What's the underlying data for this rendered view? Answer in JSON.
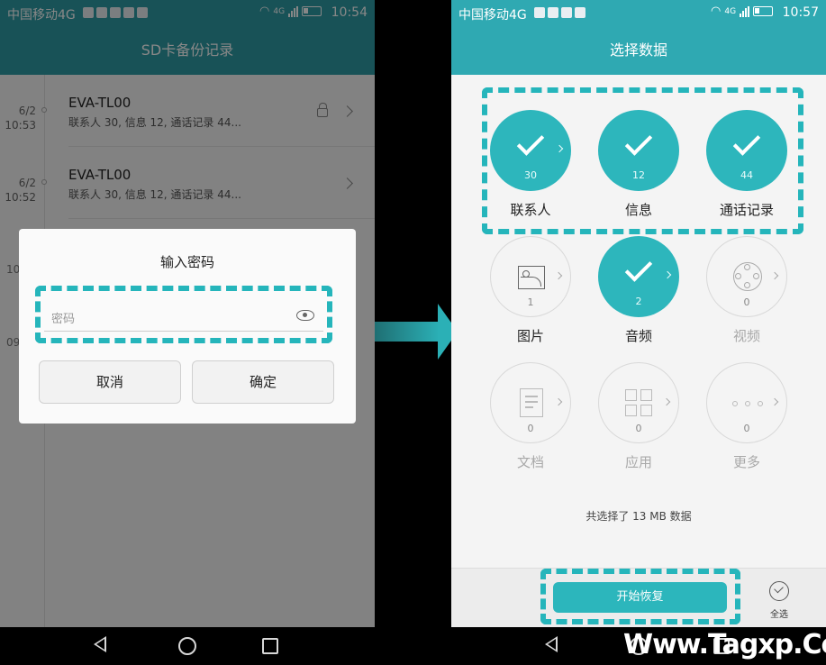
{
  "left": {
    "status": {
      "carrier": "中国移动4G",
      "time": "10:54",
      "network": "4G"
    },
    "title": "SD卡备份记录",
    "records": [
      {
        "date": "6/2",
        "time": "10:53",
        "name": "EVA-TL00",
        "detail": "联系人 30, 信息 12, 通话记录 44...",
        "locked": true
      },
      {
        "date": "6/2",
        "time": "10:52",
        "name": "EVA-TL00",
        "detail": "联系人 30, 信息 12, 通话记录 44...",
        "locked": false
      }
    ],
    "partial_dates": [
      "10",
      "09"
    ],
    "dialog": {
      "title": "输入密码",
      "password_placeholder": "密码",
      "cancel": "取消",
      "confirm": "确定"
    }
  },
  "right": {
    "status": {
      "carrier": "中国移动4G",
      "time": "10:57",
      "network": "4G"
    },
    "title": "选择数据",
    "items": [
      {
        "label": "联系人",
        "count": "30",
        "selected": true,
        "icon": "check-icon"
      },
      {
        "label": "信息",
        "count": "12",
        "selected": true,
        "icon": "check-icon"
      },
      {
        "label": "通话记录",
        "count": "44",
        "selected": true,
        "icon": "check-icon"
      },
      {
        "label": "图片",
        "count": "1",
        "selected": false,
        "enabled": true,
        "icon": "image-icon"
      },
      {
        "label": "音频",
        "count": "2",
        "selected": true,
        "icon": "check-icon"
      },
      {
        "label": "视频",
        "count": "0",
        "selected": false,
        "enabled": false,
        "icon": "film-reel-icon"
      },
      {
        "label": "文档",
        "count": "0",
        "selected": false,
        "enabled": false,
        "icon": "document-icon"
      },
      {
        "label": "应用",
        "count": "0",
        "selected": false,
        "enabled": false,
        "icon": "apps-grid-icon"
      },
      {
        "label": "更多",
        "count": "0",
        "selected": false,
        "enabled": false,
        "icon": "more-dots-icon"
      }
    ],
    "summary": "共选择了 13 MB 数据",
    "restore_button": "开始恢复",
    "select_all": "全选"
  },
  "watermark": "Www.Tagxp.Com",
  "colors": {
    "accent": "#2db6bc",
    "header_left": "#2f9ba4",
    "header_right": "#2fa9b2",
    "highlight_dash": "#25b5bb"
  }
}
